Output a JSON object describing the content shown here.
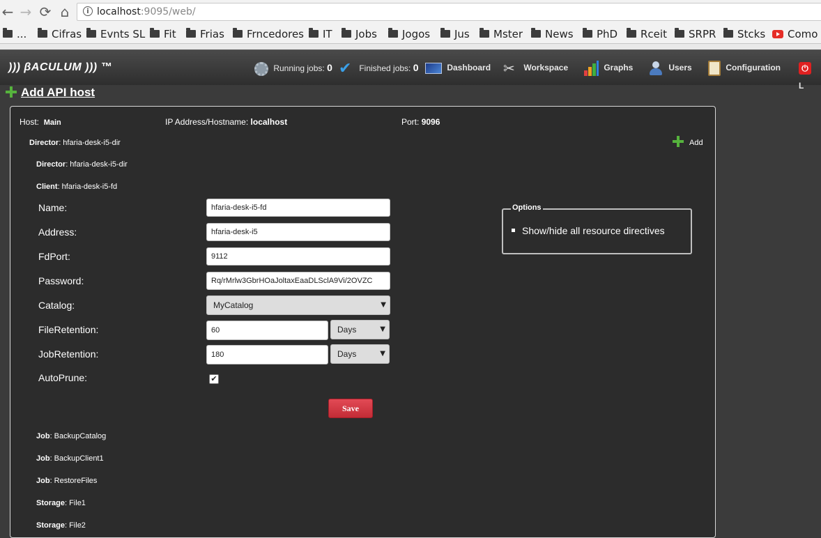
{
  "browser": {
    "back": "←",
    "forward": "→",
    "reload": "⟳",
    "home": "⌂",
    "url_host": "localhost",
    "url_path": ":9095/web/",
    "bookmarks": [
      {
        "label": "...",
        "icon": "folder-icon"
      },
      {
        "label": "Cifras",
        "icon": "folder-icon"
      },
      {
        "label": "Evnts SL",
        "icon": "folder-icon"
      },
      {
        "label": "Fit",
        "icon": "folder-icon"
      },
      {
        "label": "Frias",
        "icon": "folder-icon"
      },
      {
        "label": "Frncedores",
        "icon": "folder-icon"
      },
      {
        "label": "IT",
        "icon": "folder-icon"
      },
      {
        "label": "Jobs",
        "icon": "folder-icon"
      },
      {
        "label": "Jogos",
        "icon": "folder-icon"
      },
      {
        "label": "Jus",
        "icon": "folder-icon"
      },
      {
        "label": "Mster",
        "icon": "folder-icon"
      },
      {
        "label": "News",
        "icon": "folder-icon"
      },
      {
        "label": "PhD",
        "icon": "folder-icon"
      },
      {
        "label": "Rceit",
        "icon": "folder-icon"
      },
      {
        "label": "SRPR",
        "icon": "folder-icon"
      },
      {
        "label": "Stcks",
        "icon": "folder-icon"
      },
      {
        "label": "Como d",
        "icon": "youtube-icon"
      }
    ]
  },
  "header": {
    "logo": "))) βACULUM ))) ™",
    "running_label": "Running jobs:",
    "running_count": "0",
    "finished_label": "Finished jobs:",
    "finished_count": "0",
    "nav": {
      "dashboard": "Dashboard",
      "workspace": "Workspace",
      "graphs": "Graphs",
      "users": "Users",
      "configuration": "Configuration",
      "logout": "L"
    }
  },
  "page": {
    "add_api_host": "Add API host"
  },
  "host": {
    "host_label": "Host:",
    "host_value": "Main",
    "ip_label": "IP Address/Hostname:",
    "ip_value": "localhost",
    "port_label": "Port:",
    "port_value": "9096",
    "add_label": "Add",
    "director_label": "Director",
    "director_value": ": hfaria-desk-i5-dir",
    "sub_director_label": "Director",
    "sub_director_value": ": hfaria-desk-i5-dir",
    "client_label": "Client",
    "client_value": ": hfaria-desk-i5-fd"
  },
  "form": {
    "name_label": "Name:",
    "name_value": "hfaria-desk-i5-fd",
    "address_label": "Address:",
    "address_value": "hfaria-desk-i5",
    "fdport_label": "FdPort:",
    "fdport_value": "9112",
    "password_label": "Password:",
    "password_value": "Rq/rMrlw3GbrHOaJoltaxEaaDLSclA9Vi/2OVZC",
    "catalog_label": "Catalog:",
    "catalog_value": "MyCatalog",
    "fileretention_label": "FileRetention:",
    "fileretention_value": "60",
    "fileretention_unit": "Days",
    "jobretention_label": "JobRetention:",
    "jobretention_value": "180",
    "jobretention_unit": "Days",
    "autoprune_label": "AutoPrune:",
    "autoprune_checked": true,
    "save_label": "Save"
  },
  "options": {
    "legend": "Options",
    "item": "Show/hide all resource directives"
  },
  "resources": [
    {
      "type": "Job",
      "name": ": BackupCatalog"
    },
    {
      "type": "Job",
      "name": ": BackupClient1"
    },
    {
      "type": "Job",
      "name": ": RestoreFiles"
    },
    {
      "type": "Storage",
      "name": ": File1"
    },
    {
      "type": "Storage",
      "name": ": File2"
    }
  ]
}
